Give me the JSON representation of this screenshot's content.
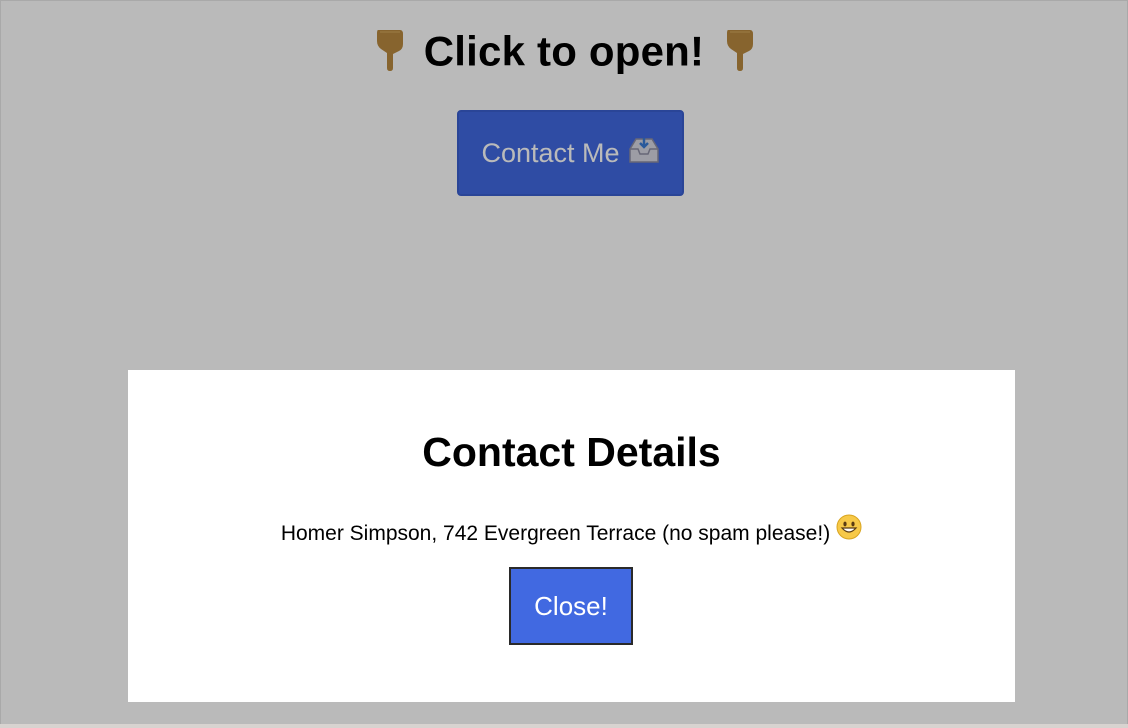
{
  "page": {
    "heading": "Click to open!",
    "heading_icon": "hand-pointing-down-icon"
  },
  "open_button": {
    "label": "Contact Me",
    "icon": "inbox-tray-icon"
  },
  "modal": {
    "title": "Contact Details",
    "text": "Homer Simpson, 742 Evergreen Terrace (no spam please!)",
    "text_icon": "grinning-face-icon",
    "close_label": "Close!"
  },
  "colors": {
    "button": "#4169e1",
    "overlay": "#b9b9b9",
    "modal_bg": "#ffffff",
    "hand": "#b98a3f"
  }
}
